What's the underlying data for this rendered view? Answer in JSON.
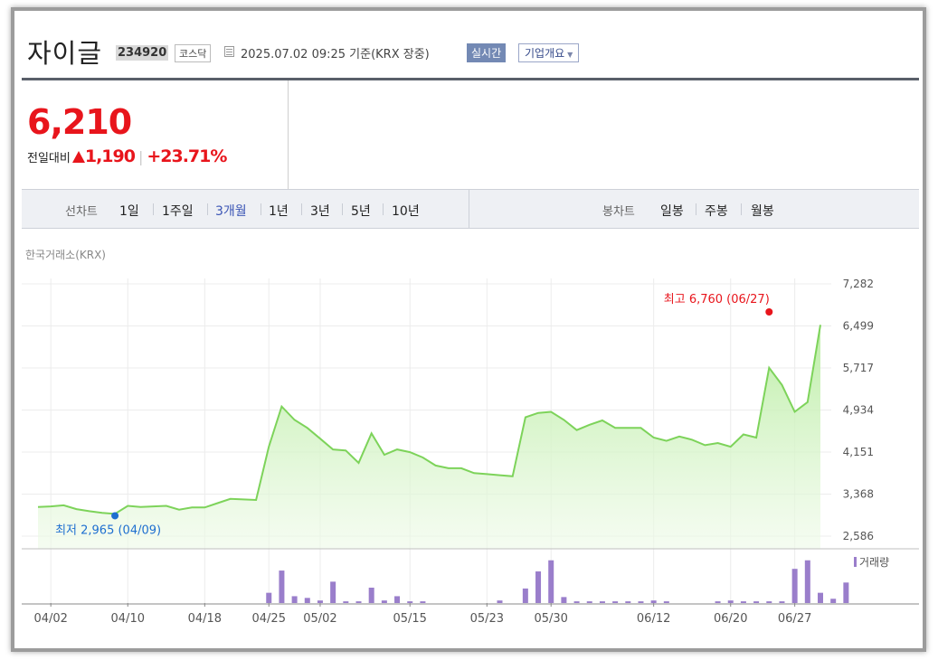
{
  "header": {
    "name": "자이글",
    "code": "234920",
    "market": "코스닥",
    "datetime": "2025.07.02 09:25  기준(KRX 장중)",
    "realtime_label": "실시간",
    "overview_label": "기업개요"
  },
  "quote": {
    "price": "6,210",
    "change_label": "전일대비",
    "change_abs": "1,190",
    "change_pct": "+23.71%",
    "up_color": "#e8151c"
  },
  "tabs": {
    "line_label": "선차트",
    "line_periods": [
      "1일",
      "1주일",
      "3개월",
      "1년",
      "3년",
      "5년",
      "10년"
    ],
    "active": "3개월",
    "candle_label": "봉차트",
    "candle_periods": [
      "일봉",
      "주봉",
      "월봉"
    ]
  },
  "chart_data": {
    "type": "area",
    "source_label": "한국거래소(KRX)",
    "line_color": "#7dd35a",
    "volume_color": "#9a7ecb",
    "high_color": "#e8151c",
    "low_color": "#1e6fd0",
    "y_ticks": [
      "7,282",
      "6,499",
      "5,717",
      "4,934",
      "4,151",
      "3,368",
      "2,586"
    ],
    "ylim": [
      2586,
      7282
    ],
    "x_ticks": [
      "04/02",
      "04/10",
      "04/18",
      "04/25",
      "05/02",
      "05/15",
      "05/23",
      "05/30",
      "06/12",
      "06/20",
      "06/27"
    ],
    "x_tick_index": [
      1,
      7,
      13,
      18,
      22,
      29,
      35,
      40,
      48,
      54,
      59
    ],
    "high_label": "최고 6,760 (06/27)",
    "high_index": 57,
    "high_value": 6760,
    "low_label": "최저 2,965 (04/09)",
    "low_index": 6,
    "low_value": 2965,
    "volume_label": "거래량",
    "series": [
      {
        "values": [
          3130,
          3140,
          3160,
          3090,
          3050,
          3020,
          3000,
          3150,
          3130,
          3140,
          3150,
          3080,
          3120,
          3120,
          3200,
          3280,
          3270,
          3260,
          4250,
          5000,
          4750,
          4600,
          4400,
          4200,
          4180,
          3950,
          4500,
          4100,
          4200,
          4150,
          4050,
          3900,
          3850,
          3850,
          3760,
          3740,
          3720,
          3700,
          4800,
          4880,
          4900,
          4750,
          4560,
          4660,
          4740,
          4600,
          4600,
          4600,
          4420,
          4360,
          4440,
          4380,
          4280,
          4320,
          4250,
          4480,
          4420,
          5720,
          5400,
          4900,
          5080,
          6520
        ]
      }
    ],
    "volume": [
      0,
      0,
      0,
      0,
      0,
      0,
      0,
      0,
      0,
      0,
      0,
      0,
      0,
      0,
      0,
      0,
      0,
      0,
      12,
      38,
      8,
      6,
      3,
      25,
      2,
      2,
      18,
      3,
      8,
      2,
      2,
      0,
      0,
      0,
      0,
      0,
      3,
      0,
      17,
      37,
      50,
      7,
      2,
      2,
      2,
      2,
      2,
      2,
      3,
      2,
      0,
      0,
      0,
      2,
      3,
      2,
      2,
      2,
      2,
      40,
      50,
      12,
      5,
      24
    ]
  }
}
